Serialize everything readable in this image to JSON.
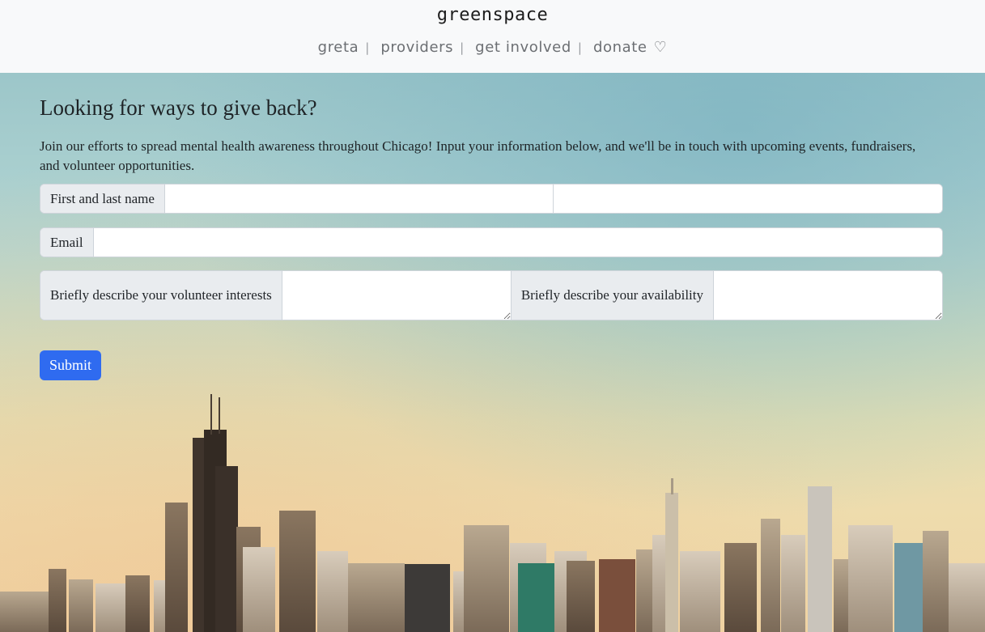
{
  "brand": "greenspace",
  "nav": {
    "items": [
      "greta",
      "providers",
      "get involved",
      "donate"
    ],
    "separator": "|",
    "donate_icon": "heart-outline-icon"
  },
  "main": {
    "headline": "Looking for ways to give back?",
    "intro": "Join our efforts to spread mental health awareness throughout Chicago! Input your information below, and we'll be in touch with upcoming events, fundraisers, and volunteer opportunities.",
    "form": {
      "name_label": "First and last name",
      "first_name_value": "",
      "last_name_value": "",
      "email_label": "Email",
      "email_value": "",
      "interests_label": "Briefly describe your volunteer interests",
      "interests_value": "",
      "availability_label": "Briefly describe your availability",
      "availability_value": "",
      "submit_label": "Submit"
    }
  },
  "colors": {
    "header_bg": "#f8f9fa",
    "primary_button": "#2f6bf0",
    "label_bg": "#e9ecef"
  }
}
